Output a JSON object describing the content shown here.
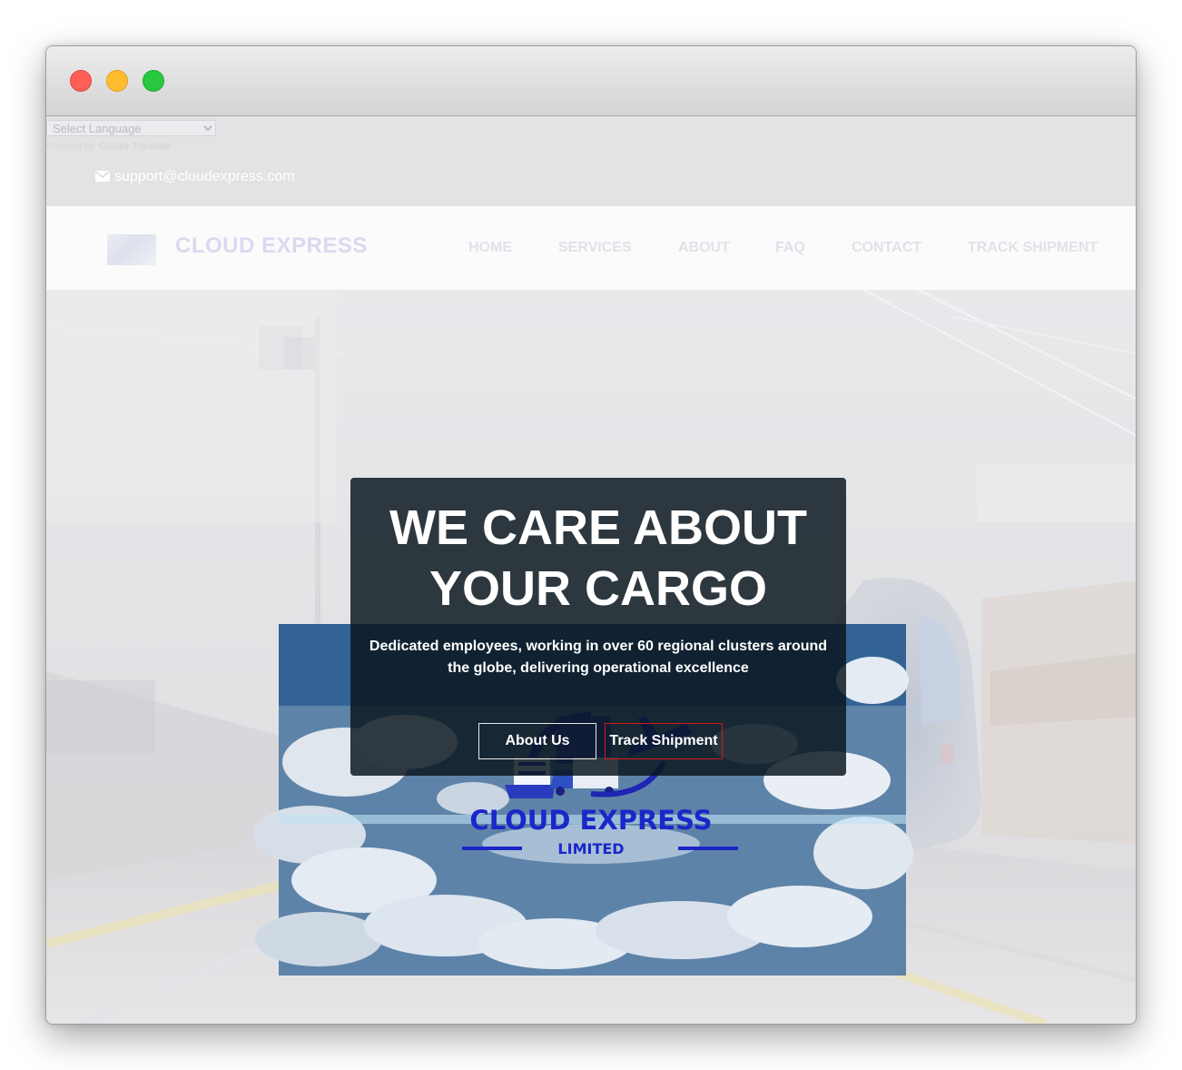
{
  "window": {
    "controls": [
      "close",
      "minimize",
      "maximize"
    ]
  },
  "topbar": {
    "language_select": "Select Language",
    "powered_by": "Powered by",
    "google": "Google",
    "translate": "Translate",
    "email_icon": "envelope-icon",
    "email": "support@cloudexpress.com"
  },
  "navbar": {
    "brand": "CLOUD EXPRESS",
    "items": [
      {
        "label": "HOME"
      },
      {
        "label": "SERVICES"
      },
      {
        "label": "ABOUT"
      },
      {
        "label": "FAQ"
      },
      {
        "label": "CONTACT"
      },
      {
        "label": "TRACK SHIPMENT"
      }
    ]
  },
  "hero": {
    "title_line1": "WE CARE ABOUT",
    "title_line2": "YOUR CARGO",
    "subtitle_line1": "Dedicated employees, working in over 60 regional clusters around",
    "subtitle_line2": "the globe, delivering operational excellence",
    "about_button": "About Us",
    "track_button": "Track Shipment",
    "logo_name": "CLOUD EXPRESS",
    "logo_sub": "LIMITED"
  },
  "colors": {
    "track_button_border": "#d41a1a",
    "logo_text": "#1b27c9",
    "close": "#fe5f57",
    "minimize": "#febc2e",
    "maximize": "#28c840"
  }
}
